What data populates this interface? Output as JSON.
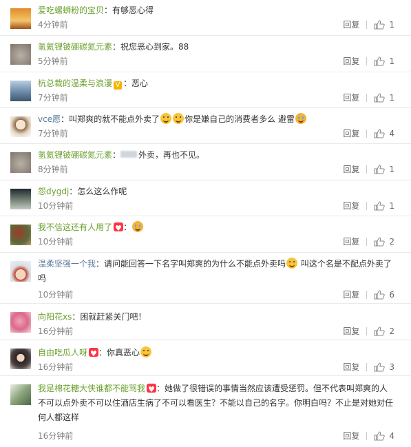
{
  "reply_label": "回复",
  "comments": [
    {
      "user": "爱吃螺蛳粉的宝贝",
      "colon": "：",
      "text": "有够恶心得",
      "time": "4分钟前",
      "likes": "1"
    },
    {
      "user": "氢氦锂铍硼碳氮元素",
      "colon": "：",
      "text": "祝您恶心到家。88",
      "time": "5分钟前",
      "likes": "1"
    },
    {
      "user": "杭总裁的温柔与浪漫",
      "colon": "：",
      "text": "恶心",
      "time": "7分钟前",
      "likes": "1"
    },
    {
      "user": "vce愿",
      "colon": "：",
      "text": "叫郑爽的就不能点外卖了",
      "text2": "你是嫌自己的消费者多么 避雷",
      "time": "7分钟前",
      "likes": "4"
    },
    {
      "user": "氢氦锂铍硼碳氮元素",
      "colon": "：",
      "text": "外卖，再也不见。",
      "time": "8分钟前",
      "likes": "1"
    },
    {
      "user": "怨dygdj",
      "colon": "：",
      "text": "怎么这么作呢",
      "time": "10分钟前",
      "likes": "1"
    },
    {
      "user": "我不信这还有人用了",
      "colon": "：",
      "text": "",
      "time": "10分钟前",
      "likes": "2"
    },
    {
      "user": "温柔坚强一个我",
      "colon": "：",
      "text": "请问能回答一下名字叫郑爽的为什么不能点外卖吗",
      "text2": "叫这个名是不配点外卖了",
      "text3": "吗",
      "time": "10分钟前",
      "likes": "6"
    },
    {
      "user": "向阳花xs",
      "colon": "：",
      "text": "困就赶紧关门吧！",
      "time": "16分钟前",
      "likes": "2"
    },
    {
      "user": "自由吃瓜人呀",
      "colon": "：",
      "text": "你真恶心",
      "time": "16分钟前",
      "likes": "3"
    },
    {
      "user": "我是棉花糖大侠谁都不能骂我",
      "colon": "：",
      "text": "她做了很错误的事情当然应该遭受惩罚。但不代表叫郑爽的人",
      "text2": "不可以点外卖不可以住酒店生病了不可以看医生？不能以自己的名字。你明白吗？不止是对她对任",
      "text3": "何人都这样",
      "time": "16分钟前",
      "likes": "4"
    }
  ]
}
